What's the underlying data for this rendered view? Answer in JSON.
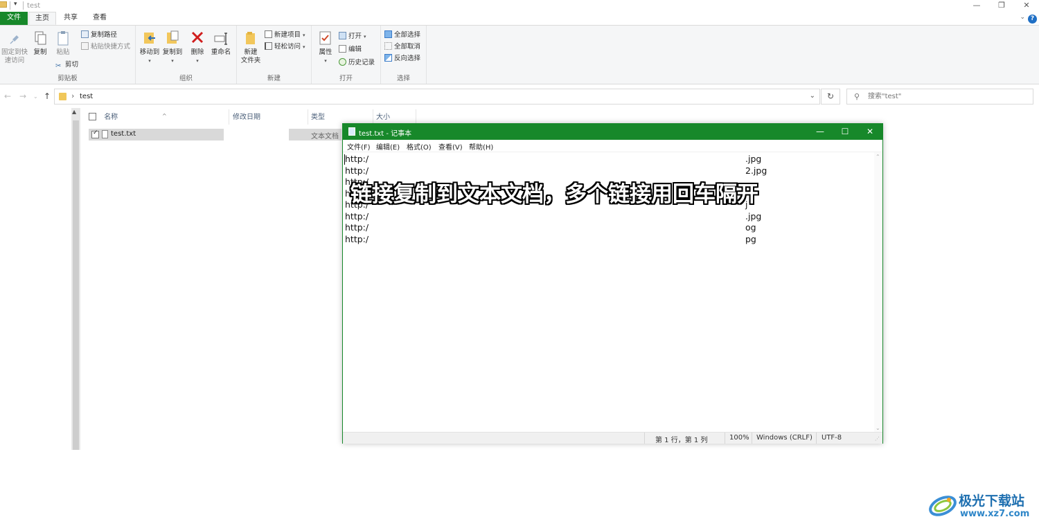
{
  "explorer": {
    "title": "test",
    "quick_access_arrow": "▾",
    "window_buttons": {
      "minimize": "—",
      "restore": "❐",
      "close": "✕"
    },
    "tabs": [
      {
        "label": "文件"
      },
      {
        "label": "主页"
      },
      {
        "label": "共享"
      },
      {
        "label": "查看"
      }
    ],
    "help": "?",
    "ribbon": {
      "clipboard": {
        "group_label": "剪贴板",
        "pin_label_1": "固定到快",
        "pin_label_2": "速访问",
        "copy": "复制",
        "paste": "粘贴",
        "copy_path": "复制路径",
        "paste_shortcut": "粘贴快捷方式",
        "cut": "剪切"
      },
      "organize": {
        "group_label": "组织",
        "move_to": "移动到",
        "copy_to": "复制到",
        "delete": "删除",
        "rename": "重命名"
      },
      "new": {
        "group_label": "新建",
        "new_folder_1": "新建",
        "new_folder_2": "文件夹",
        "new_item": "新建项目",
        "easy_access": "轻松访问"
      },
      "open": {
        "group_label": "打开",
        "properties": "属性",
        "open": "打开",
        "edit": "编辑",
        "history": "历史记录"
      },
      "select": {
        "group_label": "选择",
        "select_all": "全部选择",
        "select_none": "全部取消",
        "invert": "反向选择"
      }
    },
    "address": {
      "path": "test",
      "search_placeholder": "搜索\"test\""
    },
    "columns": [
      "名称",
      "修改日期",
      "类型",
      "大小"
    ],
    "files": [
      {
        "name": "test.txt",
        "type": "文本文档"
      }
    ]
  },
  "notepad": {
    "title": "test.txt - 记事本",
    "menu": [
      "文件(F)",
      "编辑(E)",
      "格式(O)",
      "查看(V)",
      "帮助(H)"
    ],
    "lines_left": [
      "http:/",
      "http:/",
      "http:/",
      "http:/",
      "http:/",
      "http:/",
      "http:/",
      "http:/"
    ],
    "lines_right": [
      ".jpg",
      "2.jpg",
      "",
      "",
      "j",
      ".jpg",
      "og",
      "pg"
    ],
    "status": {
      "position": "第 1 行，第 1 列",
      "zoom": "100%",
      "line_ending": "Windows (CRLF)",
      "encoding": "UTF-8"
    }
  },
  "caption": "链接复制到文本文档，多个链接用回车隔开",
  "watermark": {
    "brand": "极光下载站",
    "url": "www.xz7.com"
  },
  "colors": {
    "accent_green": "#17882a",
    "brand_blue": "#1e6fb0"
  }
}
